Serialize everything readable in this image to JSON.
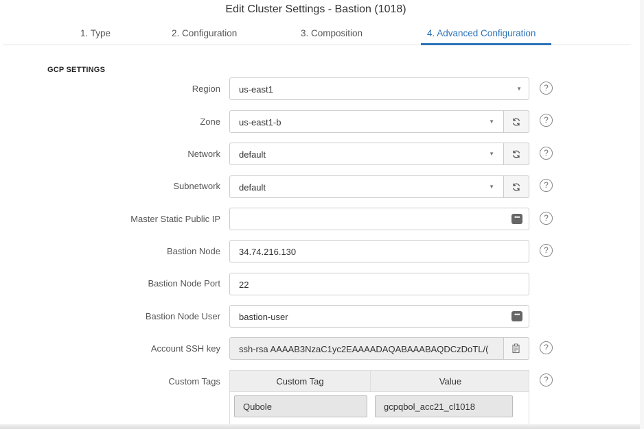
{
  "title": "Edit Cluster Settings - Bastion (1018)",
  "tabs": [
    {
      "label": "1. Type"
    },
    {
      "label": "2. Configuration"
    },
    {
      "label": "3. Composition"
    },
    {
      "label": "4. Advanced Configuration",
      "active": true
    }
  ],
  "section": {
    "title": "GCP SETTINGS"
  },
  "fields": {
    "region": {
      "label": "Region",
      "value": "us-east1"
    },
    "zone": {
      "label": "Zone",
      "value": "us-east1-b"
    },
    "network": {
      "label": "Network",
      "value": "default"
    },
    "subnetwork": {
      "label": "Subnetwork",
      "value": "default"
    },
    "master_ip": {
      "label": "Master Static Public IP",
      "value": ""
    },
    "bastion_node": {
      "label": "Bastion Node",
      "value": "34.74.216.130"
    },
    "bastion_port": {
      "label": "Bastion Node Port",
      "value": "22"
    },
    "bastion_user": {
      "label": "Bastion Node User",
      "value": "bastion-user"
    },
    "ssh_key": {
      "label": "Account SSH key",
      "value": "ssh-rsa AAAAB3NzaC1yc2EAAAADAQABAAABAQDCzDoTL/("
    }
  },
  "custom_tags": {
    "label": "Custom Tags",
    "columns": [
      "Custom Tag",
      "Value"
    ],
    "rows": [
      {
        "tag": "Qubole",
        "value": "gcpqbol_acc21_cl1018"
      }
    ]
  },
  "icons": {
    "help": "?",
    "dots": "•••"
  },
  "colors": {
    "accent": "#2a72b8"
  }
}
